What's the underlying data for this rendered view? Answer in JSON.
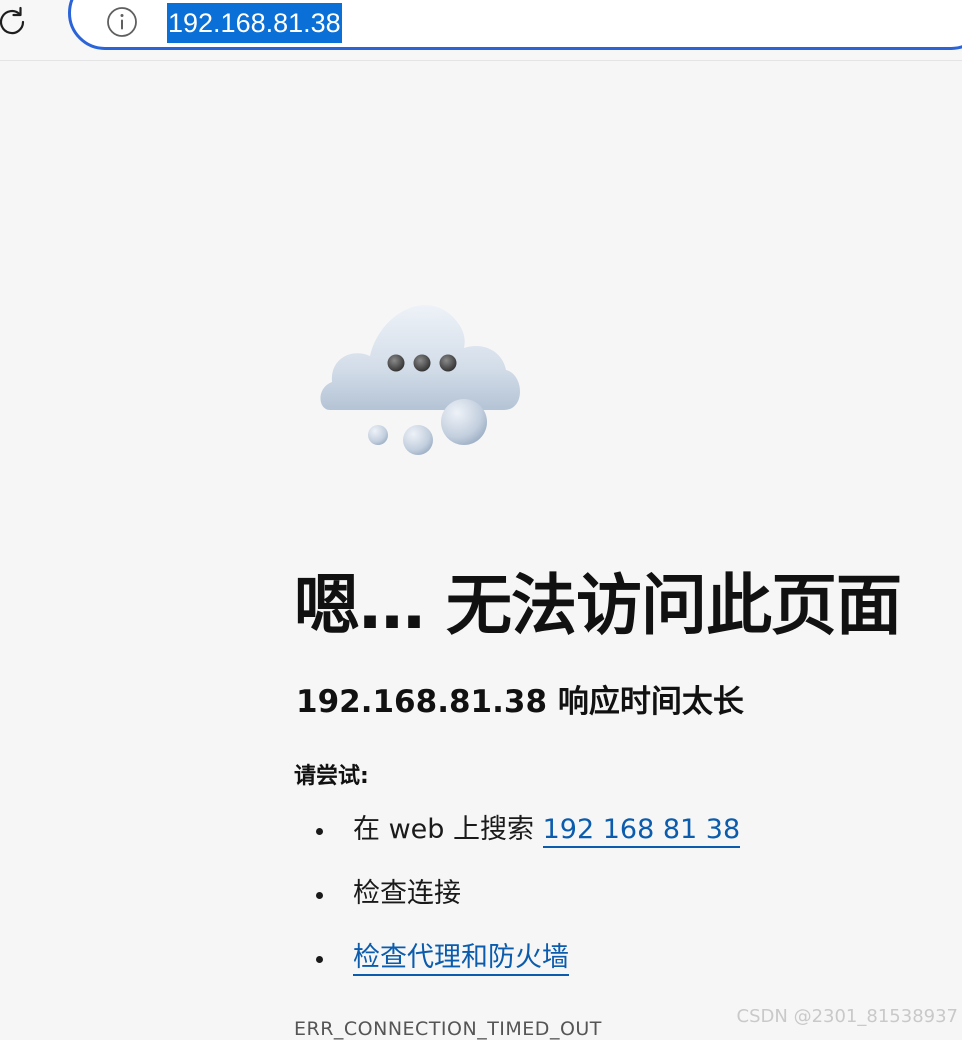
{
  "browser": {
    "url": "192.168.81.38",
    "icons": {
      "reload": "reload-icon",
      "site_info": "info-icon"
    },
    "accent_color": "#2b63d8",
    "selection_color": "#0a6fd6"
  },
  "error_page": {
    "illustration": "cloud-icon",
    "title": "嗯… 无法访问此页面",
    "subtitle": "192.168.81.38 响应时间太长",
    "try_label": "请尝试:",
    "suggestions": [
      {
        "prefix": "在 web 上搜索 ",
        "link": "192 168 81 38"
      },
      {
        "text": "检查连接"
      },
      {
        "link": "检查代理和防火墙"
      }
    ],
    "error_code": "ERR_CONNECTION_TIMED_OUT",
    "link_color": "#0b5cad"
  },
  "watermark": "CSDN @2301_81538937"
}
